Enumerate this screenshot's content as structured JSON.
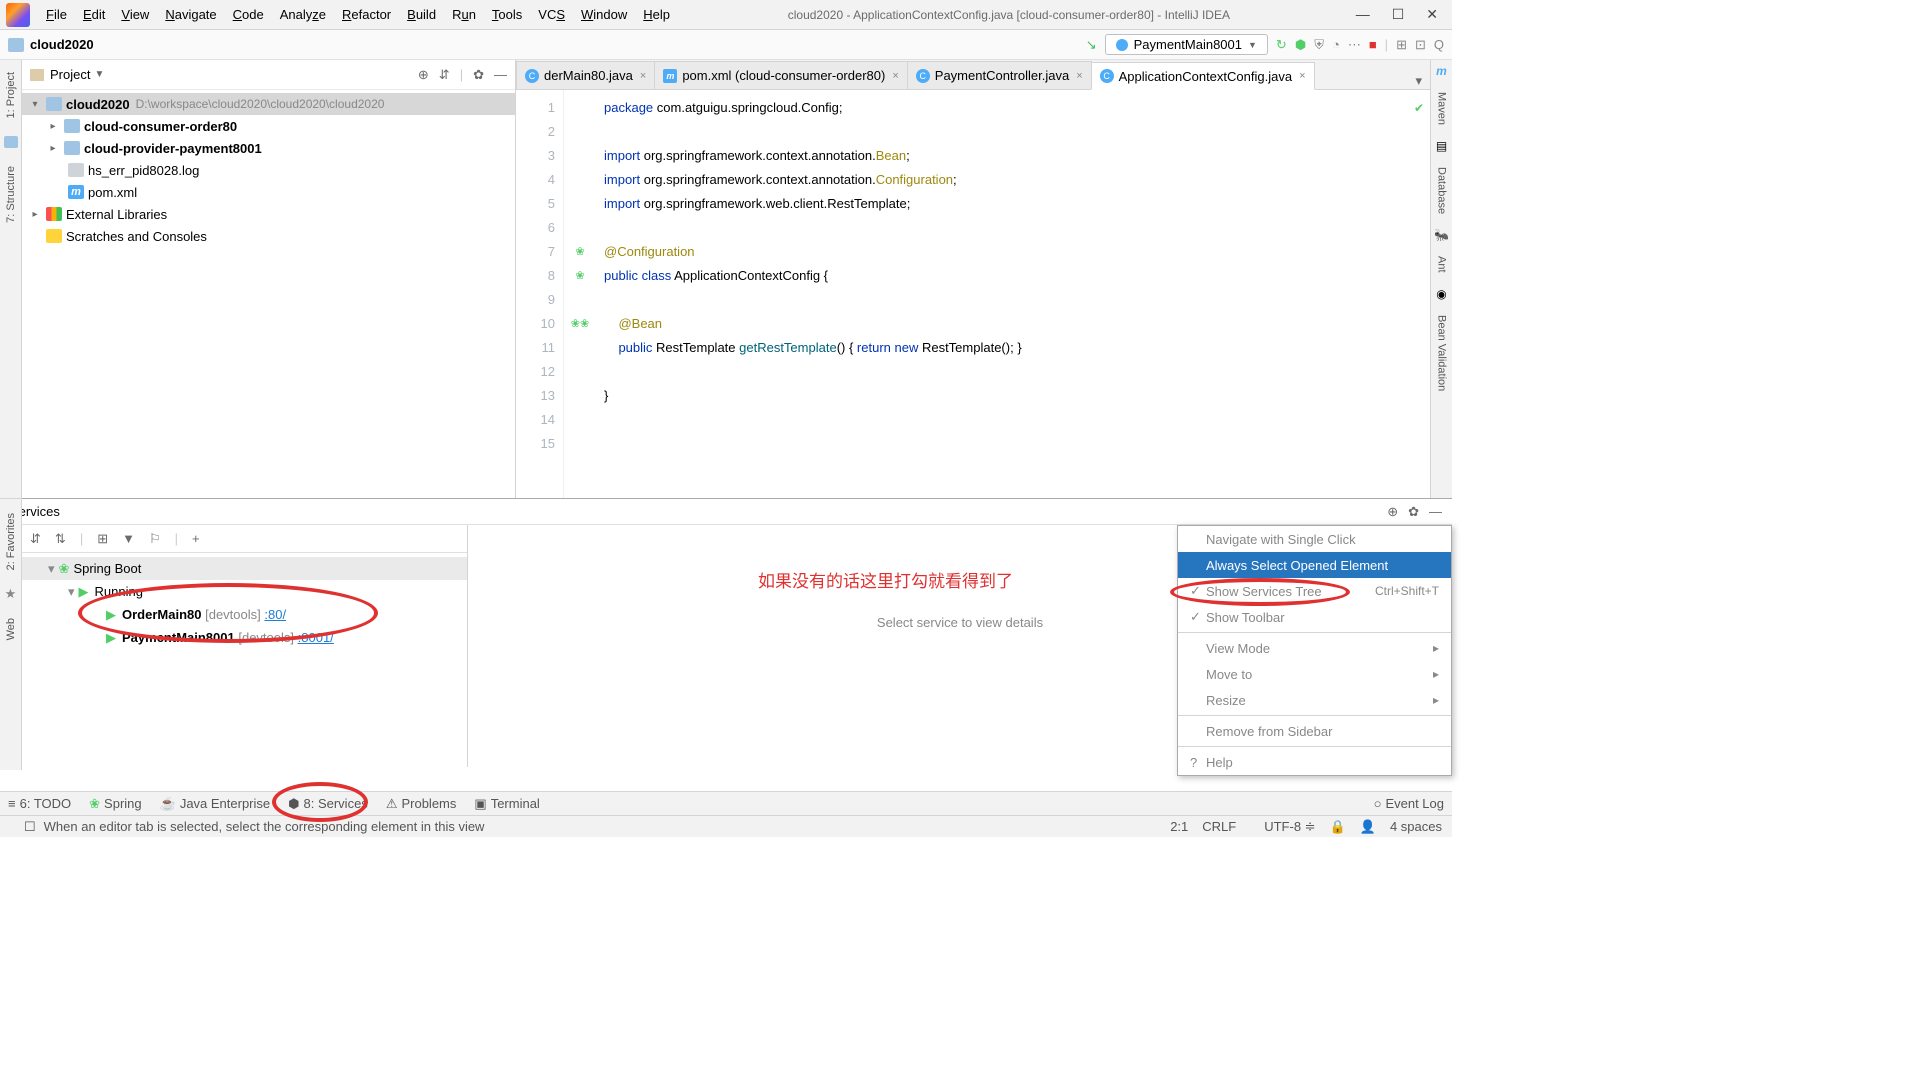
{
  "title": "cloud2020 - ApplicationContextConfig.java [cloud-consumer-order80] - IntelliJ IDEA",
  "menus": [
    "File",
    "Edit",
    "View",
    "Navigate",
    "Code",
    "Analyze",
    "Refactor",
    "Build",
    "Run",
    "Tools",
    "VCS",
    "Window",
    "Help"
  ],
  "crumb": "cloud2020",
  "runconf": "PaymentMain8001",
  "project": {
    "label": "Project",
    "root": "cloud2020",
    "rootpath": "D:\\workspace\\cloud2020\\cloud2020\\cloud2020",
    "mods": [
      "cloud-consumer-order80",
      "cloud-provider-payment8001"
    ],
    "files": [
      "hs_err_pid8028.log",
      "pom.xml"
    ],
    "extlib": "External Libraries",
    "scratch": "Scratches and Consoles"
  },
  "tabs": [
    {
      "label": "derMain80.java",
      "icon": "c"
    },
    {
      "label": "pom.xml (cloud-consumer-order80)",
      "icon": "m"
    },
    {
      "label": "PaymentController.java",
      "icon": "c"
    },
    {
      "label": "ApplicationContextConfig.java",
      "icon": "c",
      "active": true
    }
  ],
  "code": {
    "lines": [
      1,
      2,
      3,
      4,
      5,
      6,
      7,
      8,
      9,
      10,
      11,
      12,
      13,
      14,
      15
    ],
    "l1_kw": "package",
    "l1_rest": " com.atguigu.springcloud.Config;",
    "l3_kw": "import",
    "l3_rest": " org.springframework.context.annotation.",
    "l3_cls": "Bean",
    "l3_end": ";",
    "l4_kw": "import",
    "l4_rest": " org.springframework.context.annotation.",
    "l4_cls": "Configuration",
    "l4_end": ";",
    "l5_kw": "import",
    "l5_rest": " org.springframework.web.client.RestTemplate;",
    "l7": "@Configuration",
    "l8_a": "public class",
    "l8_b": " ApplicationContextConfig {",
    "l10": "@Bean",
    "l11_a": "public",
    "l11_b": " RestTemplate ",
    "l11_c": "getRestTemplate",
    "l11_d": "() { ",
    "l11_e": "return new",
    "l11_f": " RestTemplate(); }",
    "l13": "}"
  },
  "services": {
    "title": "Services",
    "root": "Spring Boot",
    "running": "Running",
    "apps": [
      {
        "name": "OrderMain80",
        "dev": "[devtools]",
        "port": ":80/"
      },
      {
        "name": "PaymentMain8001",
        "dev": "[devtools]",
        "port": ":8001/"
      }
    ],
    "placeholder": "Select service to view details"
  },
  "redtext": "如果没有的话这里打勾就看得到了",
  "ctx": [
    {
      "label": "Navigate with Single Click"
    },
    {
      "label": "Always Select Opened Element",
      "sel": true
    },
    {
      "label": "Show Services Tree",
      "chk": true,
      "sc": "Ctrl+Shift+T"
    },
    {
      "label": "Show Toolbar",
      "chk": true
    },
    {
      "sep": true
    },
    {
      "label": "View Mode",
      "sub": true
    },
    {
      "label": "Move to",
      "sub": true
    },
    {
      "label": "Resize",
      "sub": true
    },
    {
      "sep": true
    },
    {
      "label": "Remove from Sidebar"
    },
    {
      "sep": true
    },
    {
      "label": "Help",
      "q": true
    }
  ],
  "bottom": [
    "6: TODO",
    "Spring",
    "Java Enterprise",
    "8: Services",
    "Problems",
    "Terminal"
  ],
  "eventlog": "Event Log",
  "status": {
    "msg": "When an editor tab is selected, select the corresponding element in this view",
    "pos": "2:1",
    "crlf": "CRLF",
    "enc": "UTF-8",
    "indent": "4 spaces"
  },
  "leftlabels": [
    "1: Project",
    "7: Structure"
  ],
  "left2labels": [
    "2: Favorites",
    "Web"
  ],
  "rightlabels": [
    "Maven",
    "Database",
    "Ant",
    "Bean Validation"
  ]
}
